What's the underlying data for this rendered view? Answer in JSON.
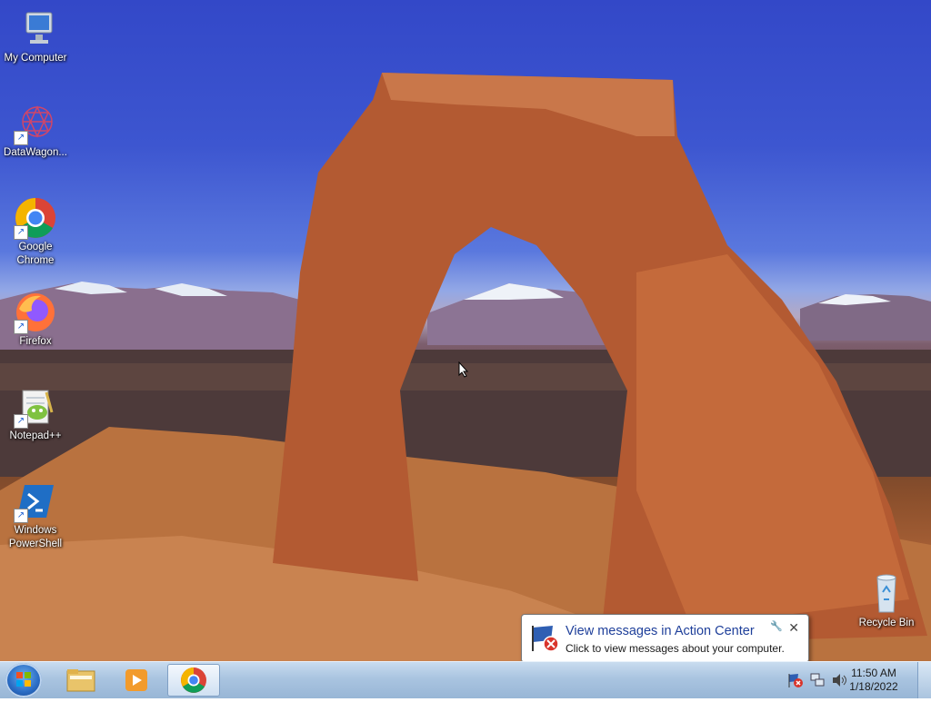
{
  "desktop": {
    "icons": [
      {
        "label": "My Computer",
        "icon": "computer-icon"
      },
      {
        "label": "DataWagon...",
        "icon": "datawagon-icon"
      },
      {
        "label": "Google Chrome",
        "icon": "chrome-icon"
      },
      {
        "label": "Firefox",
        "icon": "firefox-icon"
      },
      {
        "label": "Notepad++",
        "icon": "notepad-icon"
      },
      {
        "label": "Windows PowerShell",
        "icon": "powershell-icon"
      },
      {
        "label": "Recycle Bin",
        "icon": "recycle-bin-icon"
      }
    ]
  },
  "notification": {
    "title": "View messages in Action Center",
    "body": "Click to view messages about your computer."
  },
  "taskbar": {
    "apps": [
      {
        "name": "File Explorer",
        "icon": "folder-icon",
        "active": false
      },
      {
        "name": "Windows Media Player",
        "icon": "media-player-icon",
        "active": false
      },
      {
        "name": "Google Chrome",
        "icon": "chrome-icon",
        "active": true
      }
    ],
    "clock": {
      "time": "11:50 AM",
      "date": "1/18/2022"
    }
  }
}
